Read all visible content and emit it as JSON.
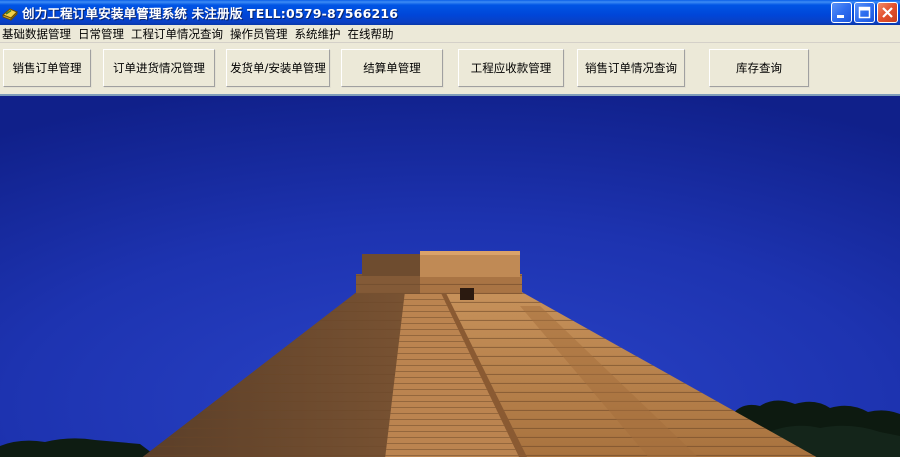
{
  "window": {
    "title": "创力工程订单安装单管理系统  未注册版  TELL:0579-87566216",
    "icon": "app-book-icon",
    "controls": [
      "minimize-icon",
      "maximize-icon",
      "close-icon"
    ]
  },
  "menu": {
    "items": [
      "基础数据管理",
      "日常管理",
      "工程订单情况查询",
      "操作员管理",
      "系统维护",
      "在线帮助"
    ]
  },
  "toolbar": {
    "buttons": [
      "销售订单管理",
      "订单进货情况管理",
      "发货单/安装单管理",
      "结算单管理",
      "工程应收款管理",
      "销售订单情况查询",
      "库存查询"
    ]
  },
  "background": {
    "description_image": "pyramid-photo",
    "sky_color": "#1c2fa8",
    "stone_color": "#b98552"
  }
}
